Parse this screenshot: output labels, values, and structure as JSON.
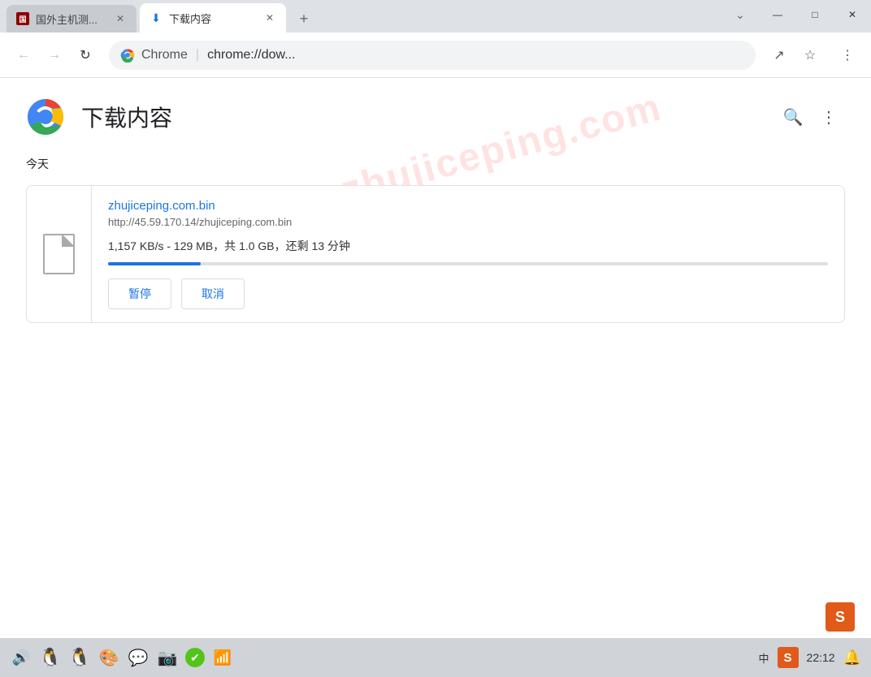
{
  "titlebar": {
    "tab_inactive_label": "国外主机测...",
    "tab_active_label": "下载内容",
    "new_tab_label": "+",
    "controls": {
      "minimize": "—",
      "maximize": "□",
      "close": "✕",
      "chevron": "⌄"
    }
  },
  "addressbar": {
    "back_btn": "←",
    "forward_btn": "→",
    "reload_btn": "↻",
    "chrome_label": "Chrome",
    "url_separator": "|",
    "url_path": "chrome://dow...",
    "share_icon": "↗",
    "star_icon": "☆",
    "menu_icon": "⋮"
  },
  "page": {
    "title": "下载内容",
    "search_icon": "🔍",
    "menu_icon": "⋮",
    "watermark": "zhujiceping.com",
    "section_today": "今天"
  },
  "download": {
    "filename": "zhujiceping.com.bin",
    "url": "http://45.59.170.14/zhujiceping.com.bin",
    "status": "1,157 KB/s - 129 MB，共 1.0 GB，还剩 13 分钟",
    "progress_percent": 12.9,
    "btn_pause": "暂停",
    "btn_cancel": "取消"
  },
  "taskbar": {
    "volume_icon": "🔊",
    "penguin1_icon": "🐧",
    "penguin2_icon": "🐧",
    "color_icon": "🎨",
    "wechat_icon": "💬",
    "camera_icon": "📷",
    "check_icon": "✔",
    "wifi_icon": "📶",
    "lang_icon": "中",
    "sogou_icon": "S",
    "time": "22:12",
    "notification_icon": "🔔"
  }
}
